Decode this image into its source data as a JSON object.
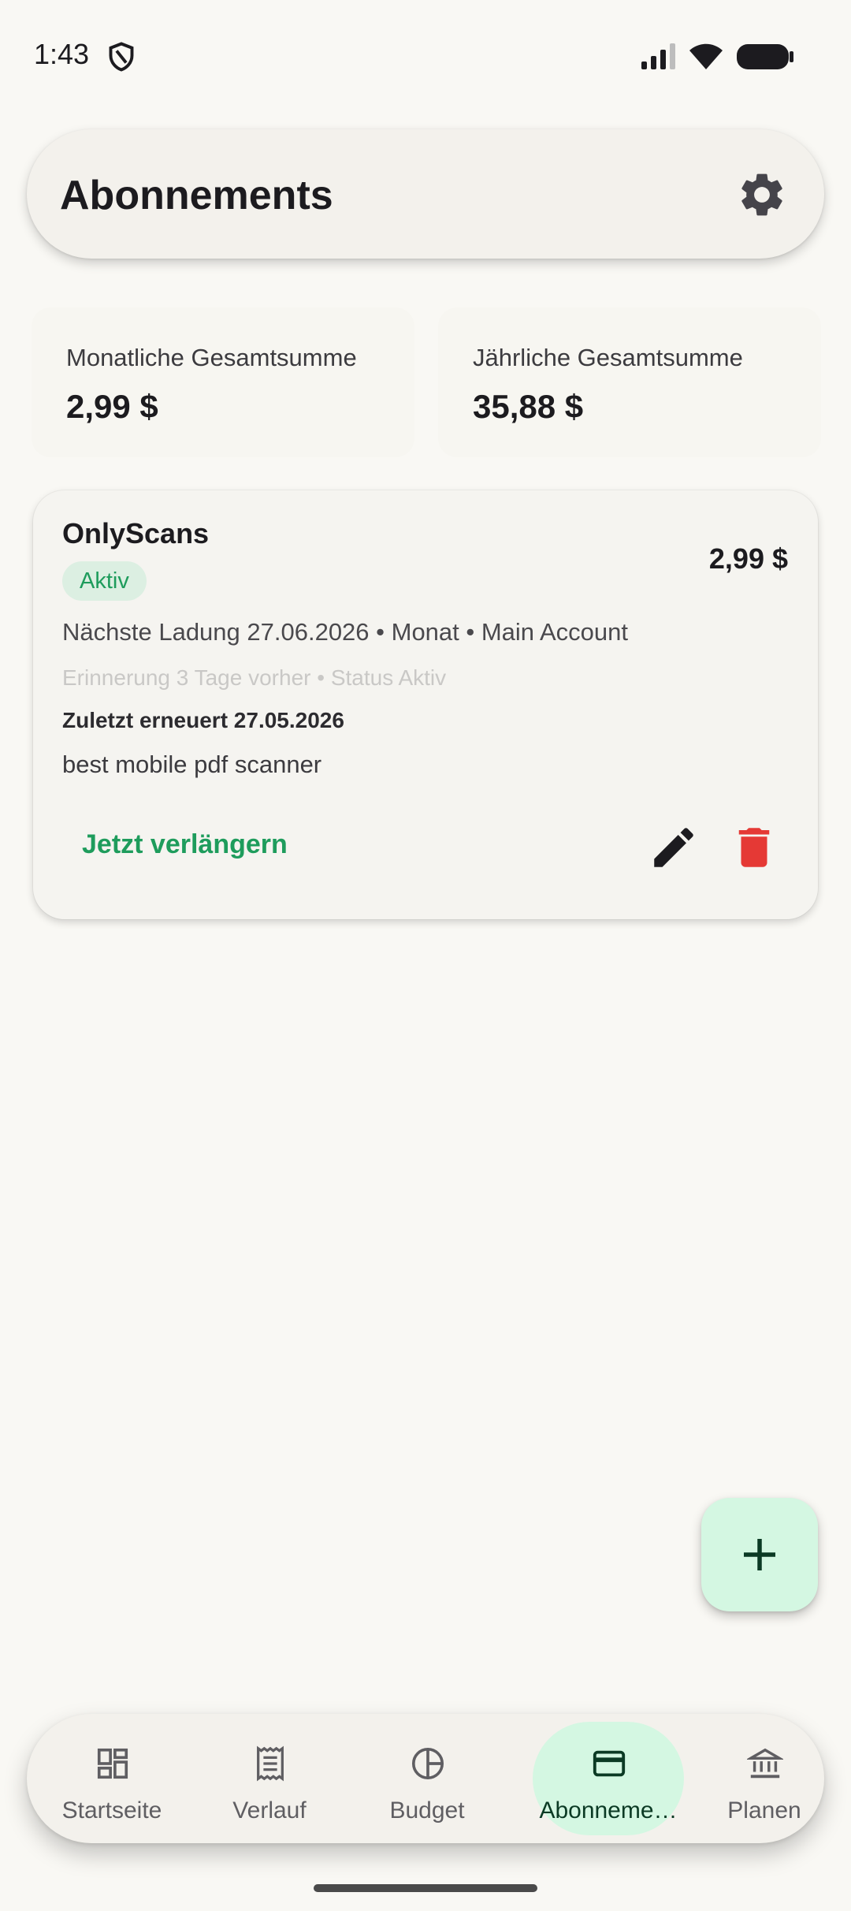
{
  "status_bar": {
    "time": "1:43"
  },
  "header": {
    "title": "Abonnements"
  },
  "summary": {
    "monthly_label": "Monatliche Gesamtsumme",
    "monthly_value": "2,99 $",
    "yearly_label": "Jährliche Gesamtsumme",
    "yearly_value": "35,88 $"
  },
  "subscriptions": [
    {
      "name": "OnlyScans",
      "price": "2,99 $",
      "status": "Aktiv",
      "next_charge": "Nächste Ladung 27.06.2026 • Monat • Main Account",
      "reminder": "Erinnerung 3 Tage vorher • Status Aktiv",
      "last_renewed": "Zuletzt erneuert 27.05.2026",
      "description": "best mobile pdf scanner",
      "renew_label": "Jetzt verlängern"
    }
  ],
  "bottom_nav": {
    "items": [
      {
        "label": "Startseite",
        "icon": "dashboard-icon"
      },
      {
        "label": "Verlauf",
        "icon": "receipt-icon"
      },
      {
        "label": "Budget",
        "icon": "pie-chart-icon"
      },
      {
        "label": "Abonneme…",
        "icon": "credit-card-icon",
        "active": true
      },
      {
        "label": "Planen",
        "icon": "bank-icon"
      }
    ]
  },
  "colors": {
    "accent": "#1e9c5c",
    "accent_container": "#d4f7e2",
    "delete": "#e53935",
    "background": "#f9f8f4"
  }
}
